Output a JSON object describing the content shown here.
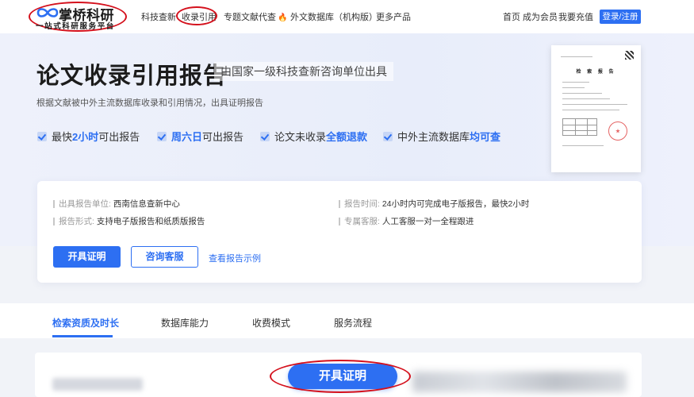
{
  "header": {
    "logo_title": "掌桥科研",
    "logo_slogan": "一站式科研服务平台",
    "nav": [
      {
        "label": "科技查新"
      },
      {
        "label": "收录引用"
      },
      {
        "label": "专题文献代查"
      },
      {
        "label": "外文数据库（机构版）"
      },
      {
        "label": "更多产品"
      }
    ],
    "right_links": [
      {
        "label": "首页"
      },
      {
        "label": "成为会员"
      },
      {
        "label": "我要充值"
      }
    ],
    "login_label": "登录/注册"
  },
  "hero": {
    "title": "论文收录引用报告",
    "subtitle": "由国家一级科技查新咨询单位出具",
    "description": "根据文献被中外主流数据库收录和引用情况，出具证明报告",
    "features": [
      {
        "pre": "最快",
        "hl": "2小时",
        "post": "可出报告"
      },
      {
        "pre": "",
        "hl": "周六日",
        "post": "可出报告"
      },
      {
        "pre": "论文未收录",
        "hl": "全额退款",
        "post": ""
      },
      {
        "pre": "中外主流数据库",
        "hl": "均可查",
        "post": ""
      }
    ],
    "report_title": "检 索 报 告"
  },
  "info_card": {
    "items": [
      {
        "key": "出具报告单位:",
        "value": "西南信息查新中心"
      },
      {
        "key": "报告时间:",
        "value": "24小时内可完成电子版报告，最快2小时"
      },
      {
        "key": "报告形式:",
        "value": "支持电子版报告和纸质版报告"
      },
      {
        "key": "专属客服:",
        "value": "人工客服一对一全程跟进"
      }
    ],
    "primary_button": "开具证明",
    "secondary_button": "咨询客服",
    "sample_link": "查看报告示例"
  },
  "tabs": [
    {
      "label": "检索资质及时长"
    },
    {
      "label": "数据库能力"
    },
    {
      "label": "收费模式"
    },
    {
      "label": "服务流程"
    }
  ],
  "cta_label": "开具证明",
  "colors": {
    "accent": "#2d6ff2",
    "annotation_red": "#d4101c"
  }
}
